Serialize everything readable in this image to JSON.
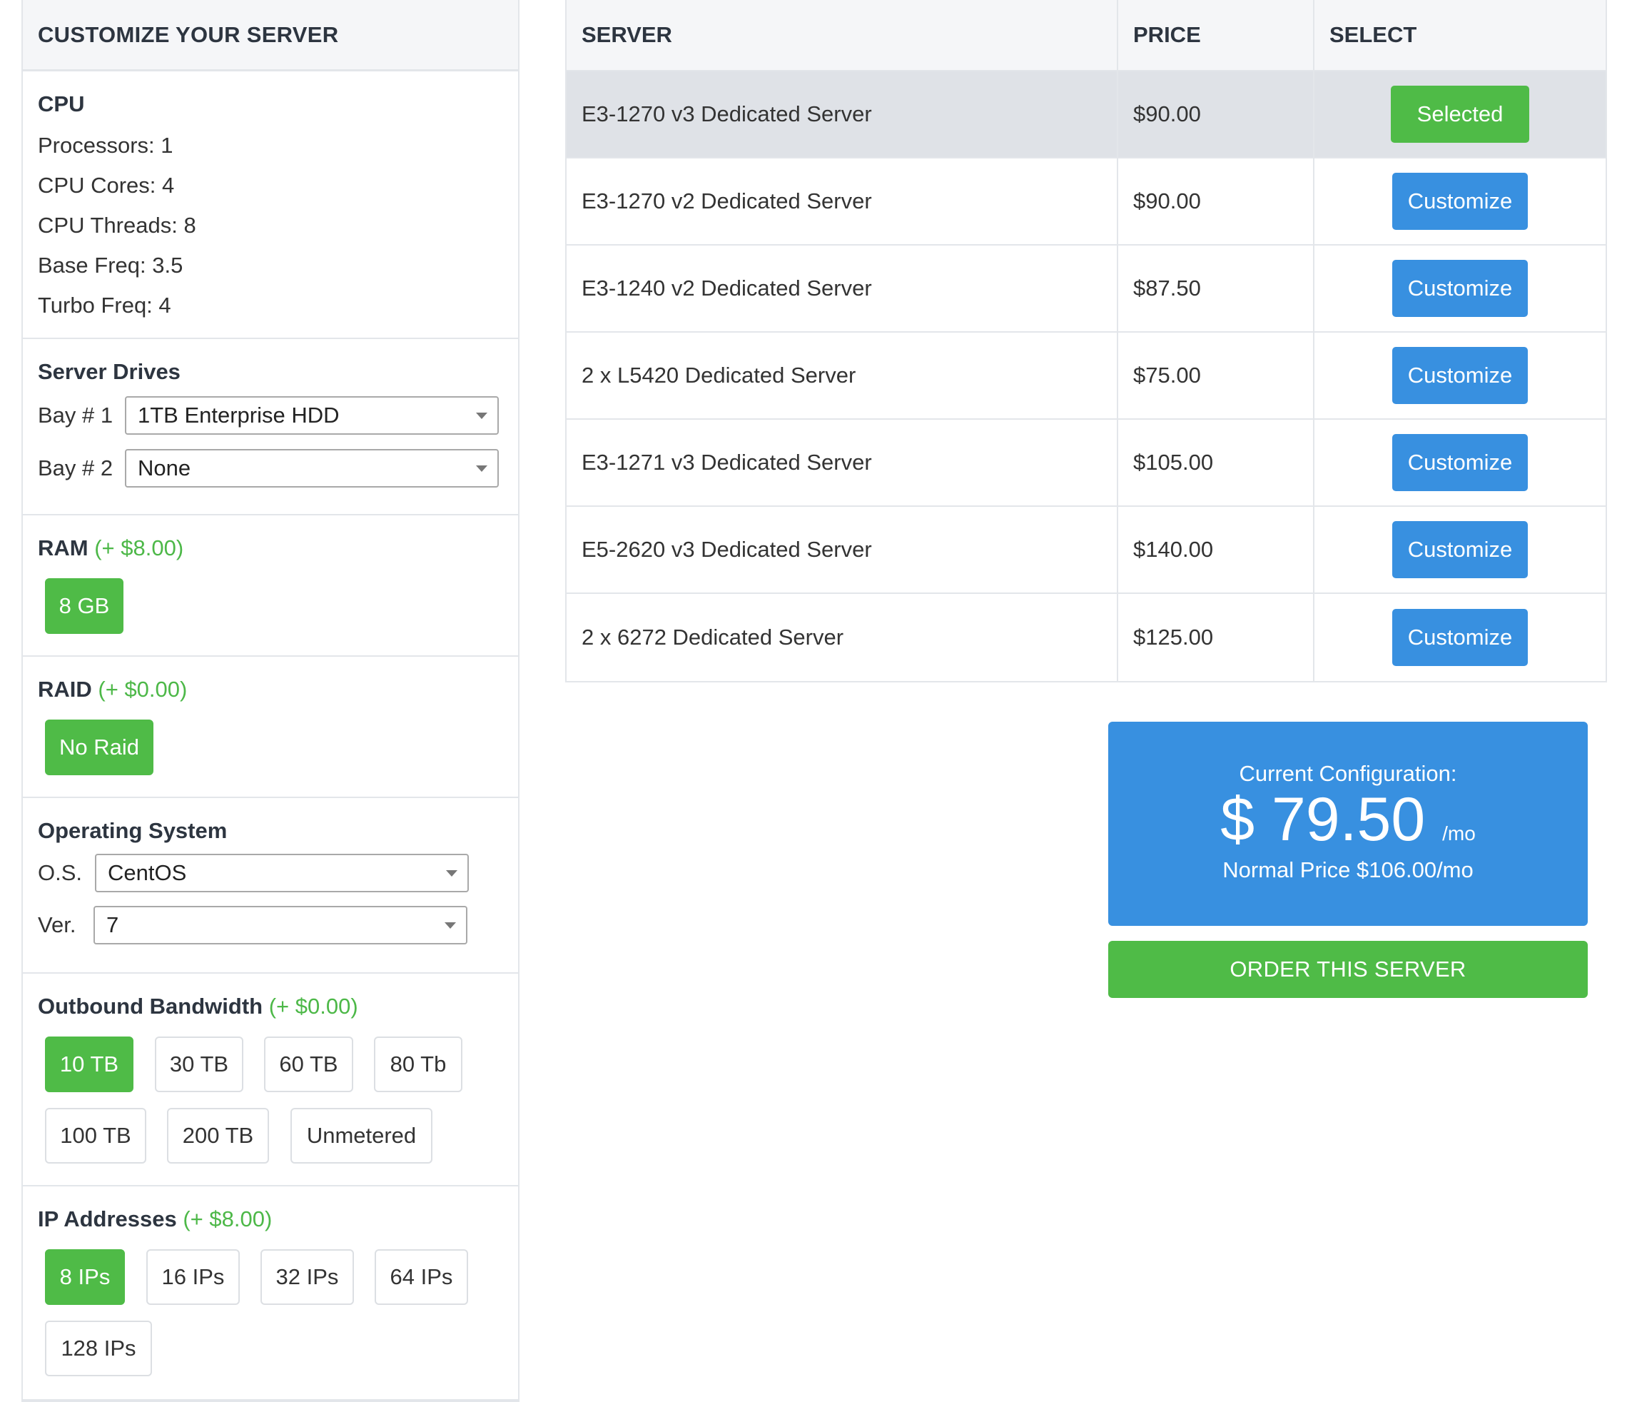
{
  "customize": {
    "title": "CUSTOMIZE YOUR SERVER",
    "cpu": {
      "title": "CPU",
      "lines": [
        "Processors: 1",
        "CPU Cores: 4",
        "CPU Threads: 8",
        "Base Freq: 3.5",
        "Turbo Freq: 4"
      ]
    },
    "drives": {
      "title": "Server Drives",
      "bays": [
        {
          "label": "Bay # 1",
          "value": "1TB Enterprise HDD"
        },
        {
          "label": "Bay # 2",
          "value": "None"
        }
      ]
    },
    "ram": {
      "title": "RAM",
      "addon": "(+ $8.00)",
      "options": [
        "8 GB"
      ]
    },
    "raid": {
      "title": "RAID",
      "addon": "(+ $0.00)",
      "options": [
        "No Raid"
      ]
    },
    "os": {
      "title": "Operating System",
      "os_label": "O.S.",
      "os_value": "CentOS",
      "ver_label": "Ver.",
      "ver_value": "7"
    },
    "bandwidth": {
      "title": "Outbound Bandwidth",
      "addon": "(+ $0.00)",
      "options": [
        "10 TB",
        "30 TB",
        "60 TB",
        "80 Tb",
        "100 TB",
        "200 TB",
        "Unmetered"
      ],
      "selected": "10 TB"
    },
    "ips": {
      "title": "IP Addresses",
      "addon": "(+ $8.00)",
      "options": [
        "8 IPs",
        "16 IPs",
        "32 IPs",
        "64 IPs",
        "128 IPs"
      ],
      "selected": "8 IPs"
    }
  },
  "servers": {
    "headers": [
      "SERVER",
      "PRICE",
      "SELECT"
    ],
    "rows": [
      {
        "name": "E3-1270 v3 Dedicated Server",
        "price": "$90.00",
        "action": "Selected"
      },
      {
        "name": "E3-1270 v2 Dedicated Server",
        "price": "$90.00",
        "action": "Customize"
      },
      {
        "name": "E3-1240 v2 Dedicated Server",
        "price": "$87.50",
        "action": "Customize"
      },
      {
        "name": "2 x L5420 Dedicated Server",
        "price": "$75.00",
        "action": "Customize"
      },
      {
        "name": "E3-1271 v3 Dedicated Server",
        "price": "$105.00",
        "action": "Customize"
      },
      {
        "name": "E5-2620 v3 Dedicated Server",
        "price": "$140.00",
        "action": "Customize"
      },
      {
        "name": "2 x 6272 Dedicated Server",
        "price": "$125.00",
        "action": "Customize"
      }
    ]
  },
  "config": {
    "label": "Current Configuration:",
    "currency": "$",
    "amount": "79.50",
    "per": "/mo",
    "normal_price": "Normal Price $106.00/mo"
  },
  "order": {
    "label": "ORDER THIS SERVER"
  },
  "colors": {
    "green": "#4fbb47",
    "blue": "#3890e0",
    "addon_green": "#4db848"
  }
}
